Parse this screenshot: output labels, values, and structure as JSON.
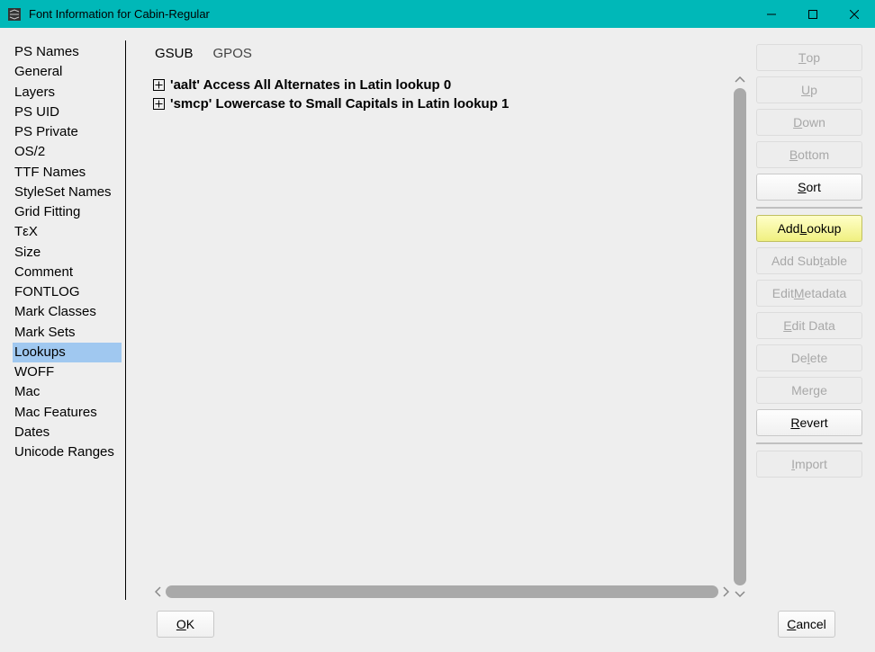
{
  "window": {
    "title": "Font Information for Cabin-Regular"
  },
  "sidebar": {
    "items": [
      "PS Names",
      "General",
      "Layers",
      "PS UID",
      "PS Private",
      "OS/2",
      "TTF Names",
      "StyleSet Names",
      "Grid Fitting",
      "TεX",
      "Size",
      "Comment",
      "FONTLOG",
      "Mark Classes",
      "Mark Sets",
      "Lookups",
      "WOFF",
      "Mac",
      "Mac Features",
      "Dates",
      "Unicode Ranges"
    ],
    "selected_index": 15
  },
  "tabs": {
    "items": [
      "GSUB",
      "GPOS"
    ],
    "active_index": 0
  },
  "lookups": [
    "'aalt' Access All Alternates in Latin lookup 0",
    "'smcp' Lowercase to Small Capitals in Latin lookup 1"
  ],
  "buttons": {
    "top": {
      "pre": "",
      "ul": "T",
      "post": "op",
      "enabled": false
    },
    "up": {
      "pre": "",
      "ul": "U",
      "post": "p",
      "enabled": false
    },
    "down": {
      "pre": "",
      "ul": "D",
      "post": "own",
      "enabled": false
    },
    "bottom": {
      "pre": "",
      "ul": "B",
      "post": "ottom",
      "enabled": false
    },
    "sort": {
      "pre": "",
      "ul": "S",
      "post": "ort",
      "enabled": true
    },
    "add_lookup": {
      "pre": "Add ",
      "ul": "L",
      "post": "ookup",
      "enabled": true,
      "highlight": true
    },
    "add_subtable": {
      "pre": "Add Sub",
      "ul": "t",
      "post": "able",
      "enabled": false
    },
    "edit_metadata": {
      "pre": "Edit ",
      "ul": "M",
      "post": "etadata",
      "enabled": false
    },
    "edit_data": {
      "pre": "",
      "ul": "E",
      "post": "dit Data",
      "enabled": false
    },
    "delete": {
      "pre": "De",
      "ul": "l",
      "post": "ete",
      "enabled": false
    },
    "merge": {
      "pre": "Mer",
      "ul": "g",
      "post": "e",
      "enabled": false
    },
    "revert": {
      "pre": "",
      "ul": "R",
      "post": "evert",
      "enabled": true
    },
    "import": {
      "pre": "",
      "ul": "I",
      "post": "mport",
      "enabled": false
    }
  },
  "footer": {
    "ok": {
      "pre": "",
      "ul": "O",
      "post": "K"
    },
    "cancel": {
      "pre": "",
      "ul": "C",
      "post": "ancel"
    }
  }
}
